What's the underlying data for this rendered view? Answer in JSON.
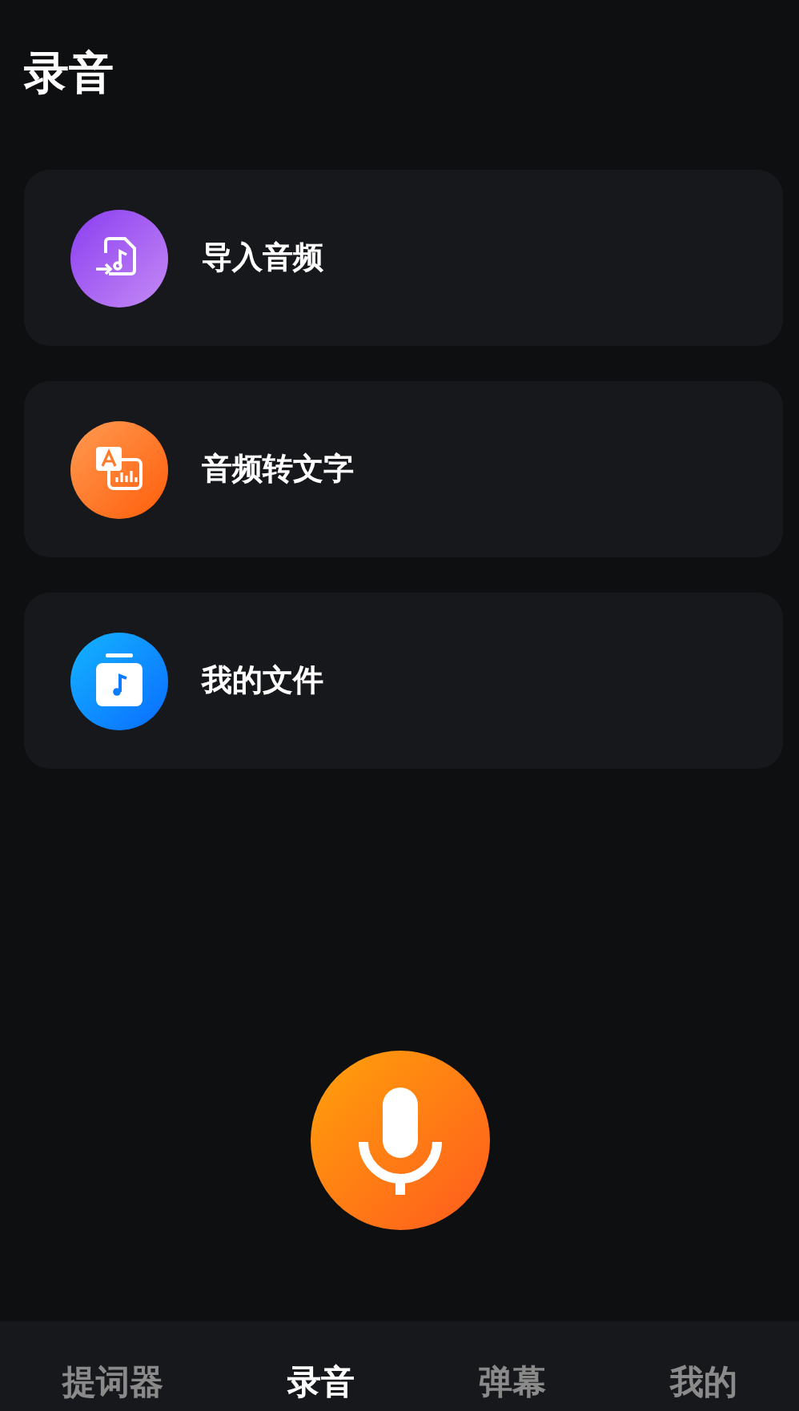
{
  "header": {
    "title": "录音"
  },
  "actions": [
    {
      "kind": "import",
      "label": "导入音频"
    },
    {
      "kind": "transcribe",
      "label": "音频转文字"
    },
    {
      "kind": "files",
      "label": "我的文件"
    }
  ],
  "record_button": {
    "kind": "mic"
  },
  "tabs": [
    {
      "label": "提词器",
      "selected": false
    },
    {
      "label": "录音",
      "selected": true
    },
    {
      "label": "弹幕",
      "selected": false
    },
    {
      "label": "我的",
      "selected": false
    }
  ]
}
